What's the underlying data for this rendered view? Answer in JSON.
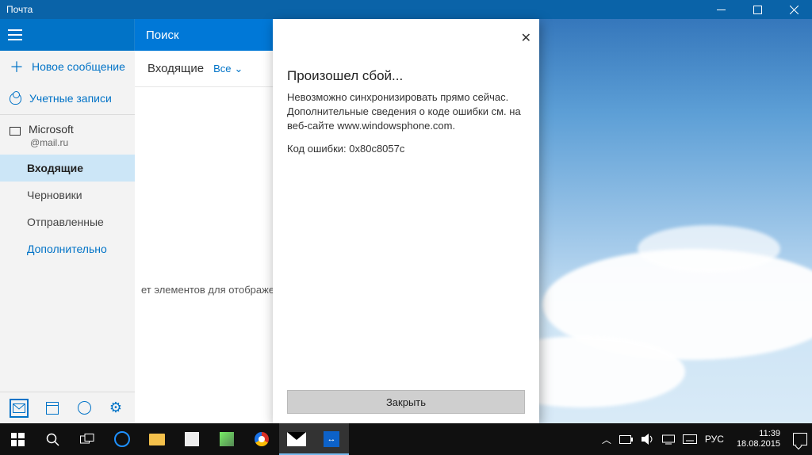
{
  "window_title": "Почта",
  "sidebar": {
    "new_message": "Новое сообщение",
    "accounts": "Учетные записи",
    "account_name": "Microsoft",
    "account_email": "@mail.ru",
    "folders": {
      "inbox": "Входящие",
      "drafts": "Черновики",
      "sent": "Отправленные",
      "more": "Дополнительно"
    }
  },
  "search": {
    "placeholder": "Поиск"
  },
  "main": {
    "folder_title": "Входящие",
    "filter_label": "Все",
    "empty_message": "ет элементов для отображения в да"
  },
  "dialog": {
    "title": "Произошел сбой...",
    "body_line1": "Невозможно синхронизировать прямо сейчас. Дополнительные сведения о коде ошибки см. на веб-сайте www.windowsphone.com.",
    "body_line2": "Код ошибки: 0x80c8057c",
    "close_button": "Закрыть"
  },
  "taskbar": {
    "lang": "РУС",
    "time": "11:39",
    "date": "18.08.2015"
  }
}
